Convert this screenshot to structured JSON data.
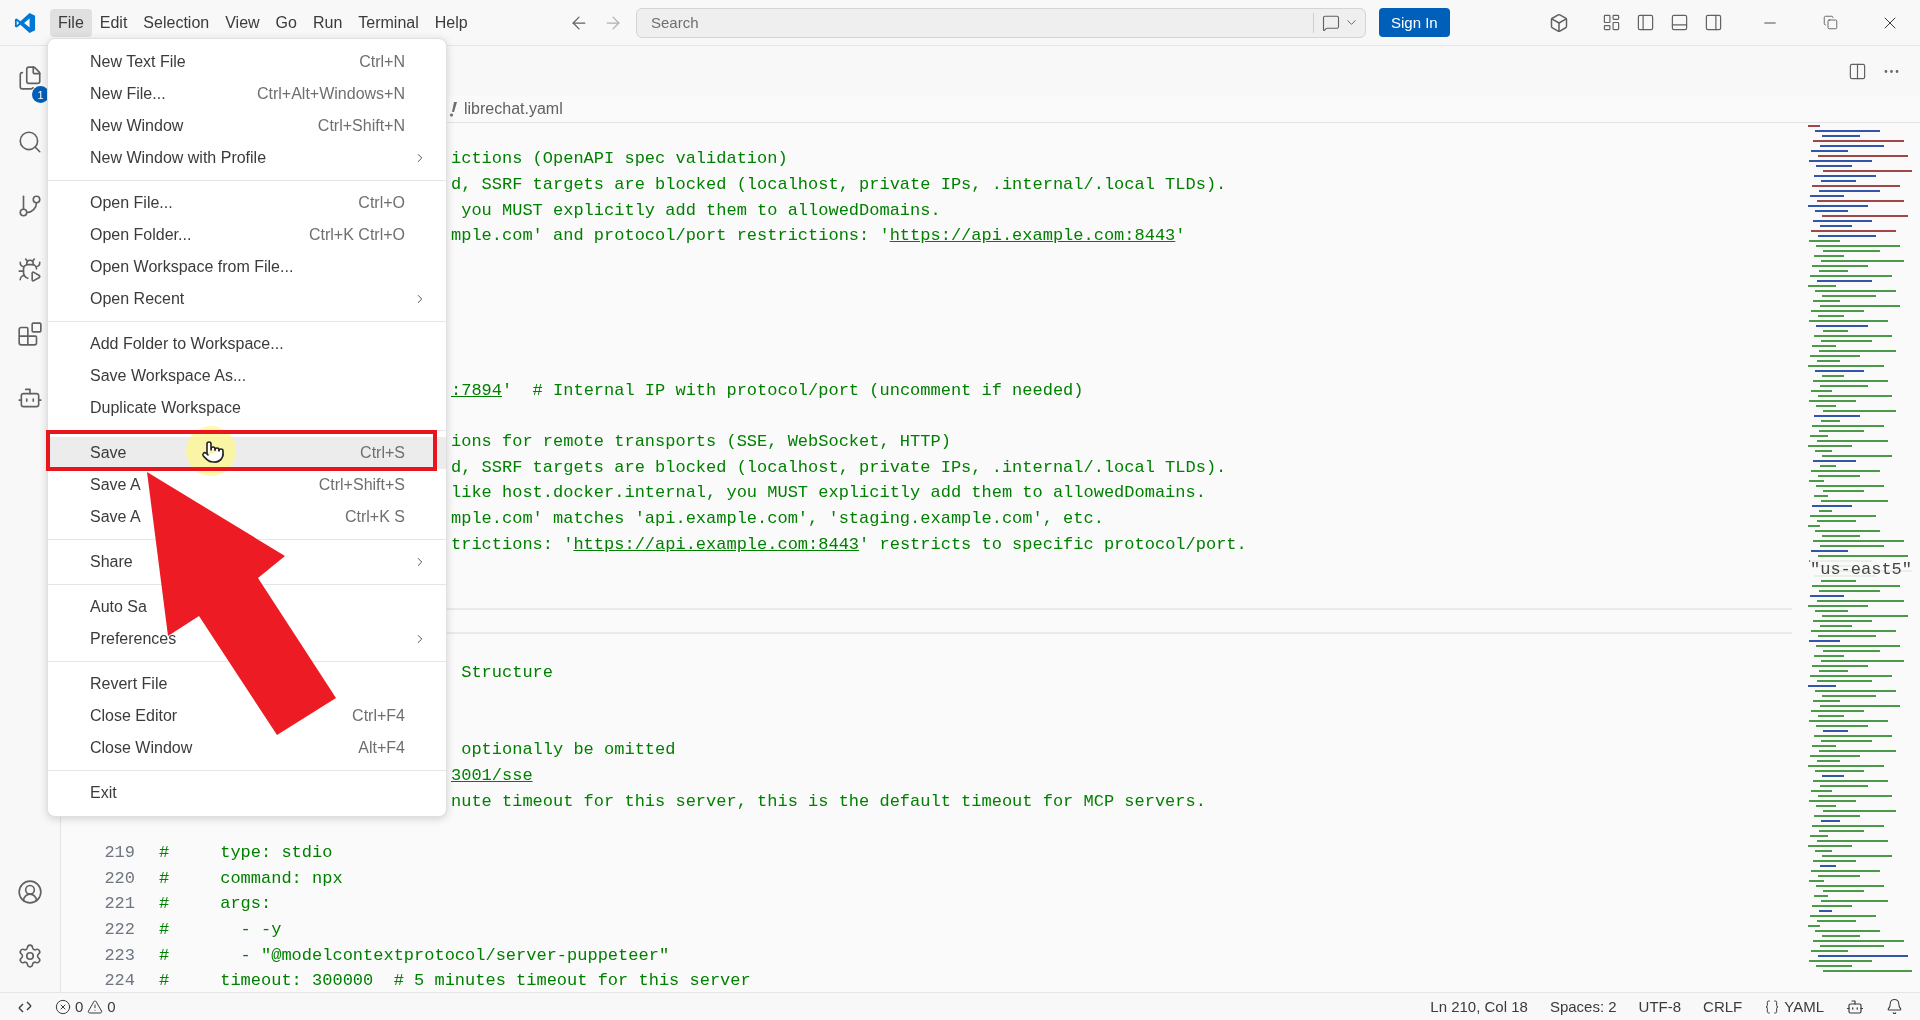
{
  "title_bar": {
    "menu": [
      {
        "label": "File",
        "selected": true
      },
      {
        "label": "Edit",
        "selected": false
      },
      {
        "label": "Selection",
        "selected": false
      },
      {
        "label": "View",
        "selected": false
      },
      {
        "label": "Go",
        "selected": false
      },
      {
        "label": "Run",
        "selected": false
      },
      {
        "label": "Terminal",
        "selected": false
      },
      {
        "label": "Help",
        "selected": false
      }
    ],
    "search": {
      "placeholder": "Search"
    },
    "sign_in": "Sign In"
  },
  "activity_bar": {
    "explorer_badge": "1"
  },
  "breadcrumb": {
    "file": "librechat.yaml"
  },
  "file_menu": {
    "groups": [
      [
        {
          "label": "New Text File",
          "shortcut": "Ctrl+N",
          "submenu": false,
          "selected": false
        },
        {
          "label": "New File...",
          "shortcut": "Ctrl+Alt+Windows+N",
          "submenu": false,
          "selected": false
        },
        {
          "label": "New Window",
          "shortcut": "Ctrl+Shift+N",
          "submenu": false,
          "selected": false
        },
        {
          "label": "New Window with Profile",
          "submenu": true,
          "selected": false
        }
      ],
      [
        {
          "label": "Open File...",
          "shortcut": "Ctrl+O",
          "submenu": false,
          "selected": false
        },
        {
          "label": "Open Folder...",
          "shortcut": "Ctrl+K Ctrl+O",
          "submenu": false,
          "selected": false
        },
        {
          "label": "Open Workspace from File...",
          "submenu": false,
          "selected": false
        },
        {
          "label": "Open Recent",
          "submenu": true,
          "selected": false
        }
      ],
      [
        {
          "label": "Add Folder to Workspace...",
          "submenu": false,
          "selected": false
        },
        {
          "label": "Save Workspace As...",
          "submenu": false,
          "selected": false
        },
        {
          "label": "Duplicate Workspace",
          "submenu": false,
          "selected": false
        }
      ],
      [
        {
          "label": "Save",
          "shortcut": "Ctrl+S",
          "submenu": false,
          "selected": true
        },
        {
          "label": "Save A",
          "shortcut": "Ctrl+Shift+S",
          "submenu": false,
          "selected": false
        },
        {
          "label": "Save A",
          "shortcut": "Ctrl+K S",
          "submenu": false,
          "selected": false
        }
      ],
      [
        {
          "label": "Share",
          "submenu": true,
          "selected": false
        }
      ],
      [
        {
          "label": "Auto Sa",
          "submenu": false,
          "selected": false
        },
        {
          "label": "Preferences",
          "submenu": true,
          "selected": false
        }
      ],
      [
        {
          "label": "Revert File",
          "submenu": false,
          "selected": false
        },
        {
          "label": "Close Editor",
          "shortcut": "Ctrl+F4",
          "submenu": false,
          "selected": false
        },
        {
          "label": "Close Window",
          "shortcut": "Alt+F4",
          "submenu": false,
          "selected": false
        }
      ],
      [
        {
          "label": "Exit",
          "submenu": false,
          "selected": false
        }
      ]
    ]
  },
  "editor": {
    "lines": [
      {
        "kind": "clipped",
        "current": false,
        "segments": [
          {
            "text": "ictions (OpenAPI spec validation)"
          }
        ]
      },
      {
        "kind": "clipped",
        "current": false,
        "segments": [
          {
            "text": "d, SSRF targets are blocked (localhost, private IPs, .internal/.local TLDs)."
          }
        ]
      },
      {
        "kind": "clipped",
        "current": false,
        "segments": [
          {
            "text": " you MUST explicitly add them to allowedDomains."
          }
        ]
      },
      {
        "kind": "clipped",
        "current": false,
        "segments": [
          {
            "text": "mple.com' and protocol/port restrictions: '"
          },
          {
            "text": "https://api.example.com:8443",
            "link": true
          },
          {
            "text": "'"
          }
        ]
      },
      {
        "kind": "blank",
        "current": false
      },
      {
        "kind": "blank",
        "current": false
      },
      {
        "kind": "blank",
        "current": false
      },
      {
        "kind": "blank",
        "current": false
      },
      {
        "kind": "blank",
        "current": false
      },
      {
        "kind": "clipped",
        "current": false,
        "segments": [
          {
            "text": ":7894",
            "link": true
          },
          {
            "text": "'  # Internal IP with protocol/port (uncomment if needed)"
          }
        ]
      },
      {
        "kind": "blank",
        "current": false
      },
      {
        "kind": "clipped",
        "current": false,
        "segments": [
          {
            "text": "ions for remote transports (SSE, WebSocket, HTTP)"
          }
        ]
      },
      {
        "kind": "clipped",
        "current": false,
        "segments": [
          {
            "text": "d, SSRF targets are blocked (localhost, private IPs, .internal/.local TLDs)."
          }
        ]
      },
      {
        "kind": "clipped",
        "current": false,
        "segments": [
          {
            "text": "like host.docker.internal, you MUST explicitly add them to allowedDomains."
          }
        ]
      },
      {
        "kind": "clipped",
        "current": false,
        "segments": [
          {
            "text": "mple.com' matches 'api.example.com', 'staging.example.com', etc."
          }
        ]
      },
      {
        "kind": "clipped",
        "current": false,
        "segments": [
          {
            "text": "trictions: '"
          },
          {
            "text": "https://api.example.com:8443",
            "link": true
          },
          {
            "text": "' restricts to specific protocol/port."
          }
        ]
      },
      {
        "kind": "blank",
        "current": false
      },
      {
        "kind": "blank",
        "current": false
      },
      {
        "kind": "blank",
        "current": true
      },
      {
        "kind": "blank",
        "current": false
      },
      {
        "kind": "clipped",
        "current": false,
        "segments": [
          {
            "text": " Structure"
          }
        ]
      },
      {
        "kind": "blank",
        "current": false
      },
      {
        "kind": "blank",
        "current": false
      },
      {
        "kind": "clipped",
        "current": false,
        "segments": [
          {
            "text": " optionally be omitted"
          }
        ]
      },
      {
        "kind": "clipped",
        "current": false,
        "segments": [
          {
            "text": "3001/sse",
            "link": true
          }
        ]
      },
      {
        "kind": "clipped",
        "current": false,
        "segments": [
          {
            "text": "nute timeout for this server, this is the default timeout for MCP servers."
          }
        ]
      },
      {
        "kind": "blank",
        "current": false
      },
      {
        "kind": "numbered",
        "number": "219",
        "current": false,
        "segments": [
          {
            "text": "#     type: stdio"
          }
        ]
      },
      {
        "kind": "numbered",
        "number": "220",
        "current": false,
        "segments": [
          {
            "text": "#     command: npx"
          }
        ]
      },
      {
        "kind": "numbered",
        "number": "221",
        "current": false,
        "segments": [
          {
            "text": "#     args:"
          }
        ]
      },
      {
        "kind": "numbered",
        "number": "222",
        "current": false,
        "segments": [
          {
            "text": "#       - -y"
          }
        ]
      },
      {
        "kind": "numbered",
        "number": "223",
        "current": false,
        "segments": [
          {
            "text": "#       - \"@modelcontextprotocol/server-puppeteer\""
          }
        ]
      },
      {
        "kind": "numbered",
        "number": "224",
        "current": false,
        "segments": [
          {
            "text": "#     timeout: 300000  # 5 minutes timeout for this server"
          }
        ]
      }
    ]
  },
  "minimap": {
    "section_label": "\"us-east5\""
  },
  "status_bar": {
    "errors": "0",
    "warnings": "0",
    "position": "Ln 210, Col 18",
    "indent": "Spaces: 2",
    "encoding": "UTF-8",
    "eol": "CRLF",
    "language": "YAML"
  }
}
